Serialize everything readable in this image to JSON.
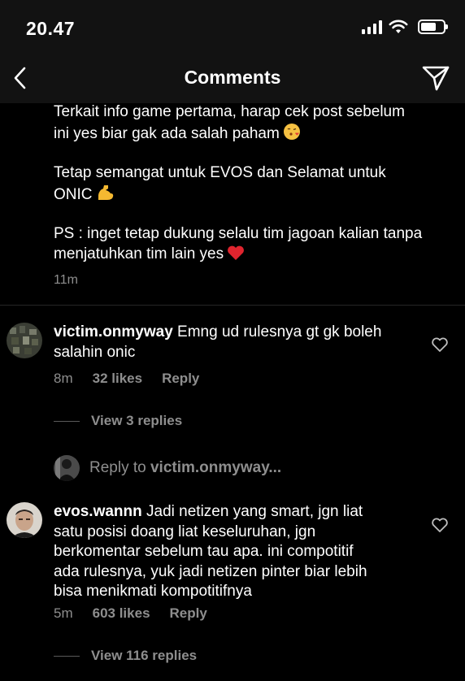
{
  "status": {
    "time": "20.47"
  },
  "nav": {
    "title": "Comments"
  },
  "caption": {
    "lines": [
      "Terkait info game pertama, harap cek post sebelum",
      "ini yes biar gak ada salah paham",
      "Tetap semangat untuk EVOS dan Selamat untuk",
      "ONIC",
      "PS : inget tetap dukung selalu tim jagoan kalian tanpa",
      "menjatuhkan tim lain yes"
    ],
    "emojis": [
      "kissing-heart",
      "flexed-biceps",
      "red-heart"
    ],
    "time": "11m"
  },
  "comments": [
    {
      "username": "victim.onmyway",
      "text_line1": " Emng ud rulesnya gt gk boleh",
      "text_line2": "salahin onic",
      "time": "8m",
      "likes": "32 likes",
      "reply_label": "Reply",
      "view_replies": "View 3 replies"
    },
    {
      "username": "evos.wannn",
      "text_line1": " Jadi netizen yang smart, jgn liat",
      "text_line2": "satu posisi doang liat keseluruhan, jgn",
      "text_line3": "berkomentar sebelum tau apa. ini compotitif",
      "text_line4": "ada rulesnya, yuk jadi netizen pinter biar lebih",
      "text_line5": "bisa menikmati kompotitifnya",
      "time": "5m",
      "likes": "603 likes",
      "reply_label": "Reply",
      "view_replies": "View 116 replies"
    }
  ],
  "reply_to": {
    "prefix": "Reply to ",
    "username": "victim.onmyway",
    "suffix": "..."
  },
  "colors": {
    "background": "#000000",
    "bar": "#121212",
    "muted": "#8e8e8e"
  },
  "icons": [
    "back-arrow-icon",
    "share-send-icon",
    "heart-icon",
    "signal-icon",
    "wifi-icon",
    "battery-icon"
  ]
}
